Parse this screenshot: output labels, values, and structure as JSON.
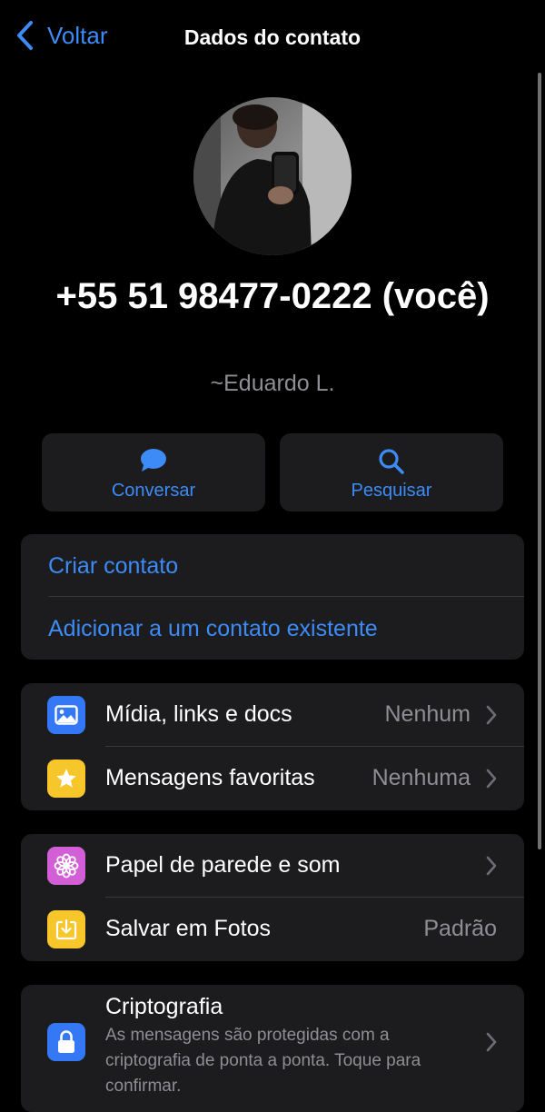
{
  "nav": {
    "back_label": "Voltar",
    "title": "Dados do contato"
  },
  "profile": {
    "phone": "+55 51 98477-0222 (você)",
    "alias": "~Eduardo L."
  },
  "actions": [
    {
      "label": "Conversar",
      "icon": "chat-bubble-icon"
    },
    {
      "label": "Pesquisar",
      "icon": "search-icon"
    }
  ],
  "contact_options": {
    "create": "Criar contato",
    "add_existing": "Adicionar a um contato existente"
  },
  "media_section": {
    "media": {
      "label": "Mídia, links e docs",
      "value": "Nenhum",
      "icon": "photo-icon"
    },
    "starred": {
      "label": "Mensagens favoritas",
      "value": "Nenhuma",
      "icon": "star-icon"
    }
  },
  "settings_section": {
    "wallpaper": {
      "label": "Papel de parede e som",
      "icon": "flower-icon"
    },
    "save_photos": {
      "label": "Salvar em Fotos",
      "value": "Padrão",
      "icon": "save-download-icon"
    }
  },
  "encryption": {
    "title": "Criptografia",
    "description": "As mensagens são protegidas com a criptografia de ponta a ponta. Toque para confirmar.",
    "icon": "lock-icon"
  },
  "colors": {
    "accent": "#3d8bf6",
    "card_bg": "#1c1c1e",
    "secondary_text": "#8e8e93"
  }
}
